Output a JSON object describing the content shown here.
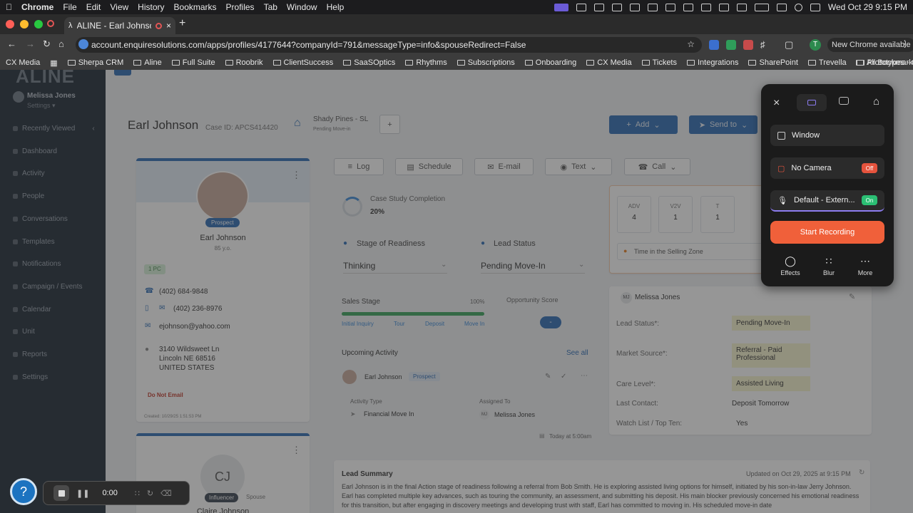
{
  "menubar": {
    "app": "Chrome",
    "items": [
      "File",
      "Edit",
      "View",
      "History",
      "Bookmarks",
      "Profiles",
      "Tab",
      "Window",
      "Help"
    ],
    "clock": "Wed Oct 29  9:15 PM"
  },
  "tab": {
    "title": "ALINE - Earl Johnson"
  },
  "address": {
    "url": "account.enquiresolutions.com/apps/profiles/4177644?companyId=791&messageType=info&spouseRedirect=False",
    "update_label": "New Chrome available",
    "profile_initial": "T"
  },
  "bookmarks": [
    "CX Media",
    "Sherpa CRM",
    "Aline",
    "Full Suite",
    "Roobrik",
    "ClientSuccess",
    "SaaSOptics",
    "Rhythms",
    "Subscriptions",
    "Onboarding",
    "CX Media",
    "Tickets",
    "Integrations",
    "SharePoint",
    "Trevella",
    "Prototypes - CRM"
  ],
  "bookmarks_all": "All Bookmarks",
  "sidebar": {
    "logo": "ALINE",
    "user": "Melissa Jones",
    "settings": "Settings ▾",
    "items": [
      "Recently Viewed",
      "Dashboard",
      "Activity",
      "People",
      "Conversations",
      "Templates",
      "Notifications",
      "Campaign / Events",
      "Calendar",
      "Unit",
      "Reports",
      "Settings"
    ]
  },
  "profile": {
    "name": "Earl Johnson",
    "case_id": "Case ID: APCS414420",
    "community": "Shady Pines - SL",
    "community_status": "Pending Move-in",
    "add_label": "Add",
    "send_label": "Send to"
  },
  "contact": {
    "badge": "Prospect",
    "name": "Earl Johnson",
    "age": "85 y.o.",
    "tag": "1 PC",
    "phone1": "(402) 684-9848",
    "phone2": "(402) 236-8976",
    "email": "ejohnson@yahoo.com",
    "address1": "3140 Wildsweet Ln",
    "address2": "Lincoln NE 68516",
    "address3": "UNITED STATES",
    "dnc": "Do Not Email",
    "created": "Created: 10/29/25 1:51:53 PM"
  },
  "spouse": {
    "initials": "CJ",
    "badge": "Influencer",
    "relation": "Spouse",
    "name": "Claire Johnson"
  },
  "actions": {
    "log": "Log",
    "schedule": "Schedule",
    "email": "E-mail",
    "text": "Text",
    "call": "Call"
  },
  "case_study": {
    "label": "Case Study Completion",
    "value": "20%"
  },
  "readiness": {
    "label": "Stage of Readiness",
    "value": "Thinking",
    "lead_label": "Lead Status",
    "lead_value": "Pending Move-In"
  },
  "sales_stage": {
    "label": "Sales Stage",
    "percent": "100%",
    "steps": [
      "Initial Inquiry",
      "Tour",
      "Deposit",
      "Move In"
    ],
    "opp_label": "Opportunity Score",
    "opp_value": "-"
  },
  "upcoming": {
    "title": "Upcoming Activity",
    "see_all": "See all",
    "person": "Earl Johnson",
    "badge": "Prospect",
    "type_label": "Activity Type",
    "type_value": "Financial Move In",
    "assigned_label": "Assigned To",
    "assigned_initials": "MJ",
    "assigned_value": "Melissa Jones",
    "time": "Today at 5:00am"
  },
  "stats": [
    {
      "k": "ADV",
      "v": "4"
    },
    {
      "k": "V2V",
      "v": "1"
    },
    {
      "k": "T",
      "v": "1"
    }
  ],
  "selling_zone": "Time in the Selling Zone",
  "owner": {
    "initials": "MJ",
    "name": "Melissa Jones"
  },
  "details": [
    {
      "k": "Lead Status*:",
      "v": "Pending Move-In"
    },
    {
      "k": "Market Source*:",
      "v": "Referral - Paid Professional"
    },
    {
      "k": "Care Level*:",
      "v": "Assisted Living"
    },
    {
      "k": "Last Contact:",
      "v": "Deposit Tomorrow"
    },
    {
      "k": "Watch List / Top Ten:",
      "v": "Yes"
    }
  ],
  "summary": {
    "title": "Lead Summary",
    "updated": "Updated on Oct 29, 2025 at 9:15 PM",
    "text": "Earl Johnson is in the final Action stage of readiness following a referral from Bob Smith. He is exploring assisted living options for himself, initiated by his son-in-law Jerry Johnson. Earl has completed multiple key advances, such as touring the community, an assessment, and submitting his deposit. His main blocker previously concerned his emotional readiness for this transition, but after engaging in discovery meetings and developing trust with staff, Earl has committed to moving in. His scheduled move-in date"
  },
  "loom": {
    "window_label": "Window",
    "camera_label": "No Camera",
    "camera_state": "Off",
    "mic_label": "Default - Extern...",
    "mic_state": "On",
    "record_label": "Start Recording",
    "effects": "Effects",
    "blur": "Blur",
    "more": "More"
  },
  "recorder": {
    "time": "0:00"
  },
  "colors": {
    "accent": "#f0603a",
    "brand": "#2f6db5",
    "on": "#2bbf74",
    "off": "#e5533d"
  }
}
